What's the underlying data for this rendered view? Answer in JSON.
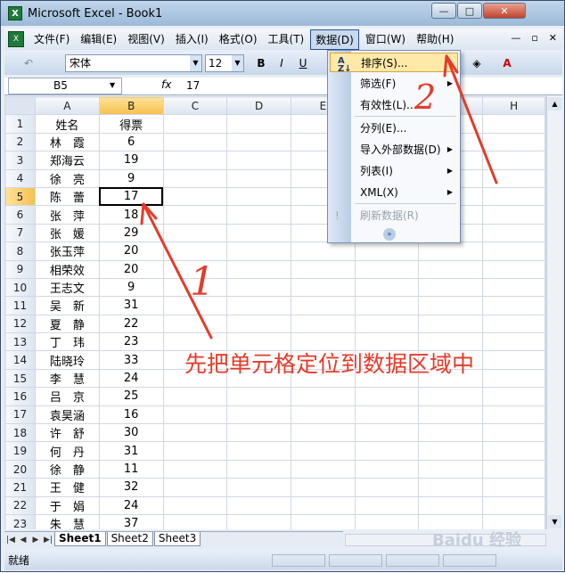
{
  "window": {
    "app_icon": "X",
    "title": "Microsoft Excel - Book1",
    "min": "—",
    "max": "□",
    "close": "✕"
  },
  "menubar": {
    "grip": "X",
    "items": [
      "文件(F)",
      "编辑(E)",
      "视图(V)",
      "插入(I)",
      "格式(O)",
      "工具(T)",
      "数据(D)",
      "窗口(W)",
      "帮助(H)"
    ],
    "active_index": 6,
    "doc_controls": [
      "—",
      "▫",
      "✕"
    ]
  },
  "toolbar": {
    "font_name": "宋体",
    "font_size": "12",
    "bold": "B",
    "italic": "I",
    "underline": "U",
    "undo": "↶",
    "fill_glyph": "◈",
    "font_color_label": "A"
  },
  "formula_bar": {
    "name_box": "B5",
    "fx": "fx",
    "value": "17"
  },
  "columns": [
    "A",
    "B",
    "C",
    "D",
    "E",
    "F",
    "G",
    "H"
  ],
  "selected_column": "B",
  "selected_row": "5",
  "rows": [
    {
      "num": "1",
      "a": "姓名",
      "b": "得票"
    },
    {
      "num": "2",
      "a": "林　霞",
      "b": "6"
    },
    {
      "num": "3",
      "a": "郑海云",
      "b": "19"
    },
    {
      "num": "4",
      "a": "徐　亮",
      "b": "9"
    },
    {
      "num": "5",
      "a": "陈　蕾",
      "b": "17"
    },
    {
      "num": "6",
      "a": "张　萍",
      "b": "18"
    },
    {
      "num": "7",
      "a": "张　媛",
      "b": "29"
    },
    {
      "num": "8",
      "a": "张玉萍",
      "b": "20"
    },
    {
      "num": "9",
      "a": "相荣效",
      "b": "20"
    },
    {
      "num": "10",
      "a": "王志文",
      "b": "9"
    },
    {
      "num": "11",
      "a": "吴　新",
      "b": "31"
    },
    {
      "num": "12",
      "a": "夏　静",
      "b": "22"
    },
    {
      "num": "13",
      "a": "丁　玮",
      "b": "23"
    },
    {
      "num": "14",
      "a": "陆晓玲",
      "b": "33"
    },
    {
      "num": "15",
      "a": "李　慧",
      "b": "24"
    },
    {
      "num": "16",
      "a": "吕　京",
      "b": "25"
    },
    {
      "num": "17",
      "a": "袁昊涵",
      "b": "16"
    },
    {
      "num": "18",
      "a": "许　舒",
      "b": "30"
    },
    {
      "num": "19",
      "a": "何　丹",
      "b": "31"
    },
    {
      "num": "20",
      "a": "徐　静",
      "b": "11"
    },
    {
      "num": "21",
      "a": "王　健",
      "b": "32"
    },
    {
      "num": "22",
      "a": "于　娟",
      "b": "24"
    },
    {
      "num": "23",
      "a": "朱　慧",
      "b": "37"
    }
  ],
  "data_menu": {
    "items": [
      {
        "label": "排序(S)...",
        "icon": "sort-icon",
        "highlighted": true
      },
      {
        "label": "筛选(F)",
        "submenu": true
      },
      {
        "label": "有效性(L)..."
      },
      {
        "label": "分列(E)..."
      },
      {
        "label": "导入外部数据(D)",
        "submenu": true
      },
      {
        "label": "列表(I)",
        "submenu": true
      },
      {
        "label": "XML(X)",
        "submenu": true
      },
      {
        "label": "刷新数据(R)",
        "disabled": true
      }
    ],
    "sort_glyph": "A\nZ↓",
    "expand_glyph": "»"
  },
  "sheets": {
    "tabs": [
      "Sheet1",
      "Sheet2",
      "Sheet3"
    ],
    "active": "Sheet1",
    "nav": [
      "|◀",
      "◀",
      "▶",
      "▶|"
    ]
  },
  "status": {
    "text": "就绪"
  },
  "annotations": {
    "instruction": "先把单元格定位到数据区域中",
    "step1": "1",
    "step2": "2"
  },
  "watermark": "Baidu 经验",
  "colors": {
    "accent": "#e53b2a",
    "menu_highlight": "#ffe9a8",
    "selected_header": "#f6c04c"
  }
}
